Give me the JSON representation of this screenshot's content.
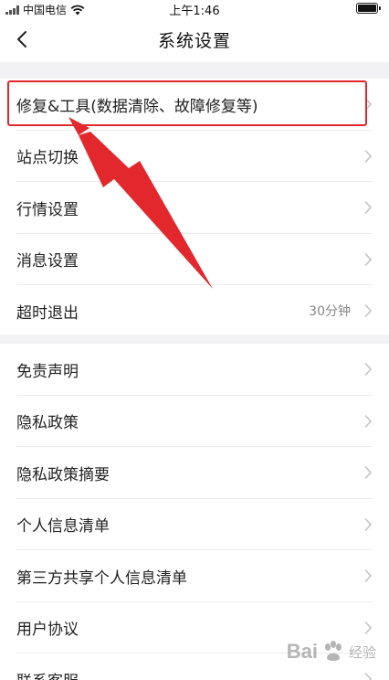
{
  "status_bar": {
    "carrier": "中国电信",
    "time": "上午1:46"
  },
  "header": {
    "title": "系统设置",
    "back_icon": "chevron-left-icon"
  },
  "settings_group_1": [
    {
      "label": "修复&工具(数据清除、故障修复等)",
      "value": ""
    },
    {
      "label": "站点切换",
      "value": ""
    },
    {
      "label": "行情设置",
      "value": ""
    },
    {
      "label": "消息设置",
      "value": ""
    },
    {
      "label": "超时退出",
      "value": "30分钟"
    }
  ],
  "settings_group_2": [
    {
      "label": "免责声明"
    },
    {
      "label": "隐私政策"
    },
    {
      "label": "隐私政策摘要"
    },
    {
      "label": "个人信息清单"
    },
    {
      "label": "第三方共享个人信息清单"
    },
    {
      "label": "用户协议"
    },
    {
      "label": "联系客服"
    }
  ],
  "annotation": {
    "highlight_color": "#e2282d"
  },
  "watermark": {
    "brand": "Bai",
    "brand_suffix": "经验"
  }
}
